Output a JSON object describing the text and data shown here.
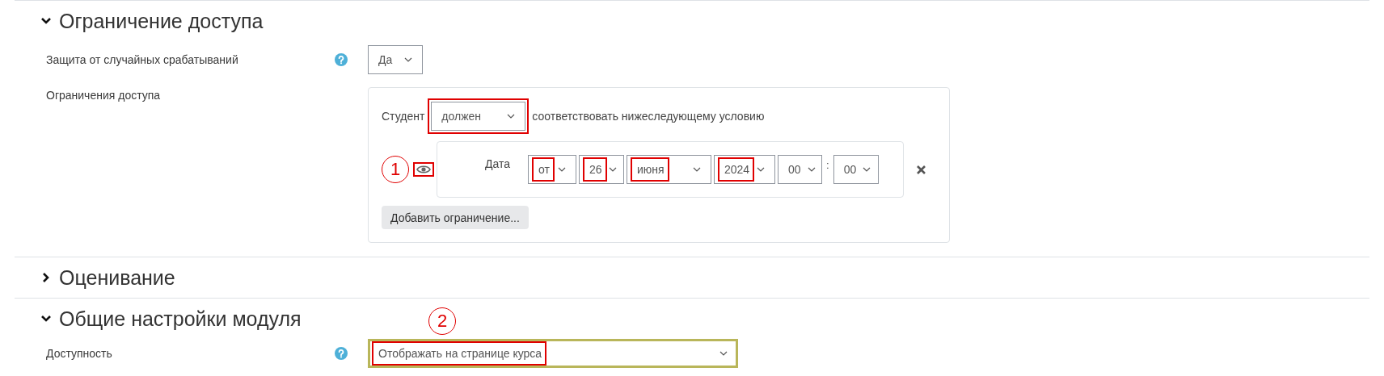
{
  "sections": [
    {
      "title": "Ограничение доступа",
      "expanded": true,
      "rows": [
        {
          "kind": "select",
          "label": "Защита от случайных срабатываний",
          "help": true,
          "value": "Да",
          "focused": false
        },
        {
          "kind": "restrictions",
          "label": "Ограничения доступа",
          "prefix": "Студент",
          "mode": {
            "value": "должен",
            "marked": true
          },
          "suffix": "соответствовать нижеследующему условию",
          "conditions": [
            {
              "callout": "1",
              "visible": true,
              "eye_marked": true,
              "label": "Дата",
              "separator": ":",
              "fields": [
                {
                  "value": "от",
                  "marked": true
                },
                {
                  "value": "26",
                  "marked": true
                },
                {
                  "value": "июня",
                  "marked": true
                },
                {
                  "value": "2024",
                  "marked": true
                },
                {
                  "value": "00",
                  "marked": false
                },
                {
                  "value": "00",
                  "marked": false
                }
              ]
            }
          ],
          "add_button": "Добавить ограничение..."
        }
      ]
    },
    {
      "title": "Оценивание",
      "expanded": false
    },
    {
      "title": "Общие настройки модуля",
      "expanded": true,
      "callout": "2",
      "rows": [
        {
          "kind": "select",
          "label": "Доступность",
          "help": true,
          "value": "Отображать на странице курса",
          "marked": true,
          "focused": true
        }
      ]
    }
  ]
}
